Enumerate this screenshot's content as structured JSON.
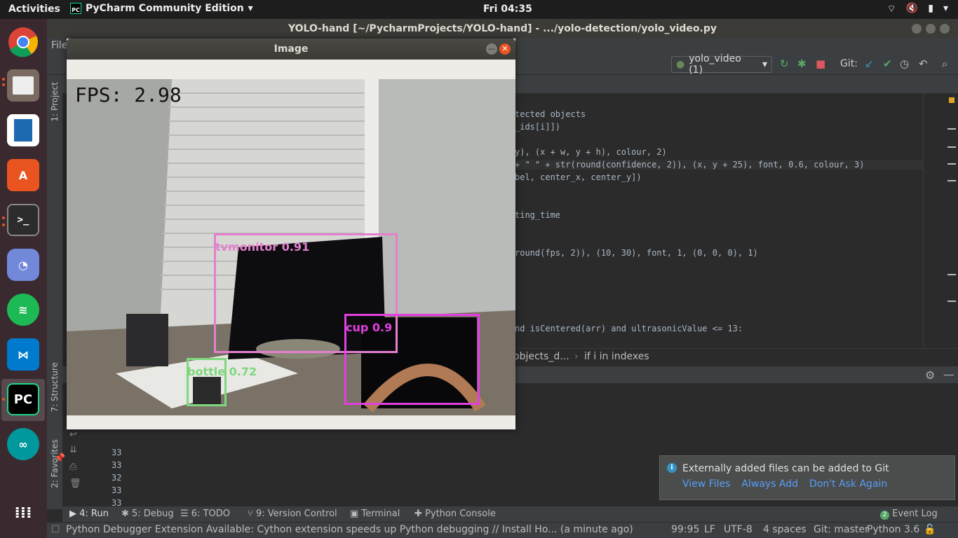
{
  "topbar": {
    "activities": "Activities",
    "app_name": "PyCharm Community Edition",
    "clock": "Fri 04:35"
  },
  "ide": {
    "window_title": "YOLO-hand [~/PycharmProjects/YOLO-hand] - .../yolo-detection/yolo_video.py",
    "menu_file": "File",
    "run_config": "yolo_video (1)",
    "git_label": "Git:",
    "sidebar_project": "1: Project",
    "sidebar_structure": "7: Structure",
    "sidebar_favorites": "2: Favorites"
  },
  "code_lines": [
    "tected objects",
    "_ids[i]])",
    "",
    "y), (x + w, y + h), colour, 2)",
    "+ \" \" + str(round(confidence, 2)), (x, y + 25), font, 0.6, colour, 3)",
    "bel, center_x, center_y])",
    "",
    "",
    "ting_time",
    "",
    "",
    "round(fps, 2)), (10, 30), font, 1, (0, 0, 0), 1)",
    "",
    "",
    "",
    "",
    "",
    "nd isCentered(arr) and ultrasonicValue <= 13:"
  ],
  "breadcrumb": {
    "part1": "objects_d...",
    "part2": "if i in indexes"
  },
  "run_output": [
    "33",
    "33",
    "32",
    "33",
    "33"
  ],
  "bottom_tabs": {
    "run": "4: Run",
    "debug": "5: Debug",
    "todo": "6: TODO",
    "vcs": "9: Version Control",
    "terminal": "Terminal",
    "console": "Python Console",
    "event_log": "Event Log",
    "event_count": "2"
  },
  "notification": {
    "message": "Externally added files can be added to Git",
    "view_files": "View Files",
    "always_add": "Always Add",
    "dont_ask": "Don't Ask Again"
  },
  "status": {
    "message": "Python Debugger Extension Available: Cython extension speeds up Python debugging // Install   Ho... (a minute ago)",
    "position": "99:95",
    "line_sep": "LF",
    "encoding": "UTF-8",
    "indent": "4 spaces",
    "git_branch": "Git: master",
    "interpreter": "Python 3.6"
  },
  "image_window": {
    "title": "Image",
    "fps_text": "FPS: 2.98",
    "detections": [
      {
        "label": "tvmonitor 0.91",
        "color": "#e47fcf"
      },
      {
        "label": "cup 0.9",
        "color": "#e23fe0"
      },
      {
        "label": "bottle 0.72",
        "color": "#7fd77f"
      }
    ]
  },
  "dock": [
    "chrome-icon",
    "files-icon",
    "writer-icon",
    "software-icon",
    "terminal-icon",
    "discord-icon",
    "spotify-icon",
    "vscode-icon",
    "pycharm-icon",
    "arduino-icon",
    "show-apps-icon"
  ]
}
